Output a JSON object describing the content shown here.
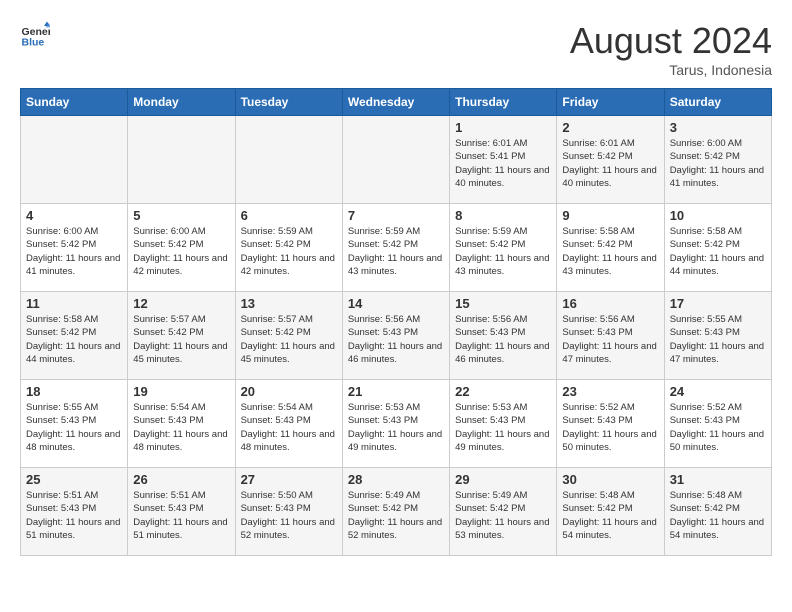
{
  "header": {
    "logo_general": "General",
    "logo_blue": "Blue",
    "month_title": "August 2024",
    "location": "Tarus, Indonesia"
  },
  "days_of_week": [
    "Sunday",
    "Monday",
    "Tuesday",
    "Wednesday",
    "Thursday",
    "Friday",
    "Saturday"
  ],
  "weeks": [
    [
      {
        "day": "",
        "info": ""
      },
      {
        "day": "",
        "info": ""
      },
      {
        "day": "",
        "info": ""
      },
      {
        "day": "",
        "info": ""
      },
      {
        "day": "1",
        "info": "Sunrise: 6:01 AM\nSunset: 5:41 PM\nDaylight: 11 hours and 40 minutes."
      },
      {
        "day": "2",
        "info": "Sunrise: 6:01 AM\nSunset: 5:42 PM\nDaylight: 11 hours and 40 minutes."
      },
      {
        "day": "3",
        "info": "Sunrise: 6:00 AM\nSunset: 5:42 PM\nDaylight: 11 hours and 41 minutes."
      }
    ],
    [
      {
        "day": "4",
        "info": "Sunrise: 6:00 AM\nSunset: 5:42 PM\nDaylight: 11 hours and 41 minutes."
      },
      {
        "day": "5",
        "info": "Sunrise: 6:00 AM\nSunset: 5:42 PM\nDaylight: 11 hours and 42 minutes."
      },
      {
        "day": "6",
        "info": "Sunrise: 5:59 AM\nSunset: 5:42 PM\nDaylight: 11 hours and 42 minutes."
      },
      {
        "day": "7",
        "info": "Sunrise: 5:59 AM\nSunset: 5:42 PM\nDaylight: 11 hours and 43 minutes."
      },
      {
        "day": "8",
        "info": "Sunrise: 5:59 AM\nSunset: 5:42 PM\nDaylight: 11 hours and 43 minutes."
      },
      {
        "day": "9",
        "info": "Sunrise: 5:58 AM\nSunset: 5:42 PM\nDaylight: 11 hours and 43 minutes."
      },
      {
        "day": "10",
        "info": "Sunrise: 5:58 AM\nSunset: 5:42 PM\nDaylight: 11 hours and 44 minutes."
      }
    ],
    [
      {
        "day": "11",
        "info": "Sunrise: 5:58 AM\nSunset: 5:42 PM\nDaylight: 11 hours and 44 minutes."
      },
      {
        "day": "12",
        "info": "Sunrise: 5:57 AM\nSunset: 5:42 PM\nDaylight: 11 hours and 45 minutes."
      },
      {
        "day": "13",
        "info": "Sunrise: 5:57 AM\nSunset: 5:42 PM\nDaylight: 11 hours and 45 minutes."
      },
      {
        "day": "14",
        "info": "Sunrise: 5:56 AM\nSunset: 5:43 PM\nDaylight: 11 hours and 46 minutes."
      },
      {
        "day": "15",
        "info": "Sunrise: 5:56 AM\nSunset: 5:43 PM\nDaylight: 11 hours and 46 minutes."
      },
      {
        "day": "16",
        "info": "Sunrise: 5:56 AM\nSunset: 5:43 PM\nDaylight: 11 hours and 47 minutes."
      },
      {
        "day": "17",
        "info": "Sunrise: 5:55 AM\nSunset: 5:43 PM\nDaylight: 11 hours and 47 minutes."
      }
    ],
    [
      {
        "day": "18",
        "info": "Sunrise: 5:55 AM\nSunset: 5:43 PM\nDaylight: 11 hours and 48 minutes."
      },
      {
        "day": "19",
        "info": "Sunrise: 5:54 AM\nSunset: 5:43 PM\nDaylight: 11 hours and 48 minutes."
      },
      {
        "day": "20",
        "info": "Sunrise: 5:54 AM\nSunset: 5:43 PM\nDaylight: 11 hours and 48 minutes."
      },
      {
        "day": "21",
        "info": "Sunrise: 5:53 AM\nSunset: 5:43 PM\nDaylight: 11 hours and 49 minutes."
      },
      {
        "day": "22",
        "info": "Sunrise: 5:53 AM\nSunset: 5:43 PM\nDaylight: 11 hours and 49 minutes."
      },
      {
        "day": "23",
        "info": "Sunrise: 5:52 AM\nSunset: 5:43 PM\nDaylight: 11 hours and 50 minutes."
      },
      {
        "day": "24",
        "info": "Sunrise: 5:52 AM\nSunset: 5:43 PM\nDaylight: 11 hours and 50 minutes."
      }
    ],
    [
      {
        "day": "25",
        "info": "Sunrise: 5:51 AM\nSunset: 5:43 PM\nDaylight: 11 hours and 51 minutes."
      },
      {
        "day": "26",
        "info": "Sunrise: 5:51 AM\nSunset: 5:43 PM\nDaylight: 11 hours and 51 minutes."
      },
      {
        "day": "27",
        "info": "Sunrise: 5:50 AM\nSunset: 5:43 PM\nDaylight: 11 hours and 52 minutes."
      },
      {
        "day": "28",
        "info": "Sunrise: 5:49 AM\nSunset: 5:42 PM\nDaylight: 11 hours and 52 minutes."
      },
      {
        "day": "29",
        "info": "Sunrise: 5:49 AM\nSunset: 5:42 PM\nDaylight: 11 hours and 53 minutes."
      },
      {
        "day": "30",
        "info": "Sunrise: 5:48 AM\nSunset: 5:42 PM\nDaylight: 11 hours and 54 minutes."
      },
      {
        "day": "31",
        "info": "Sunrise: 5:48 AM\nSunset: 5:42 PM\nDaylight: 11 hours and 54 minutes."
      }
    ]
  ]
}
